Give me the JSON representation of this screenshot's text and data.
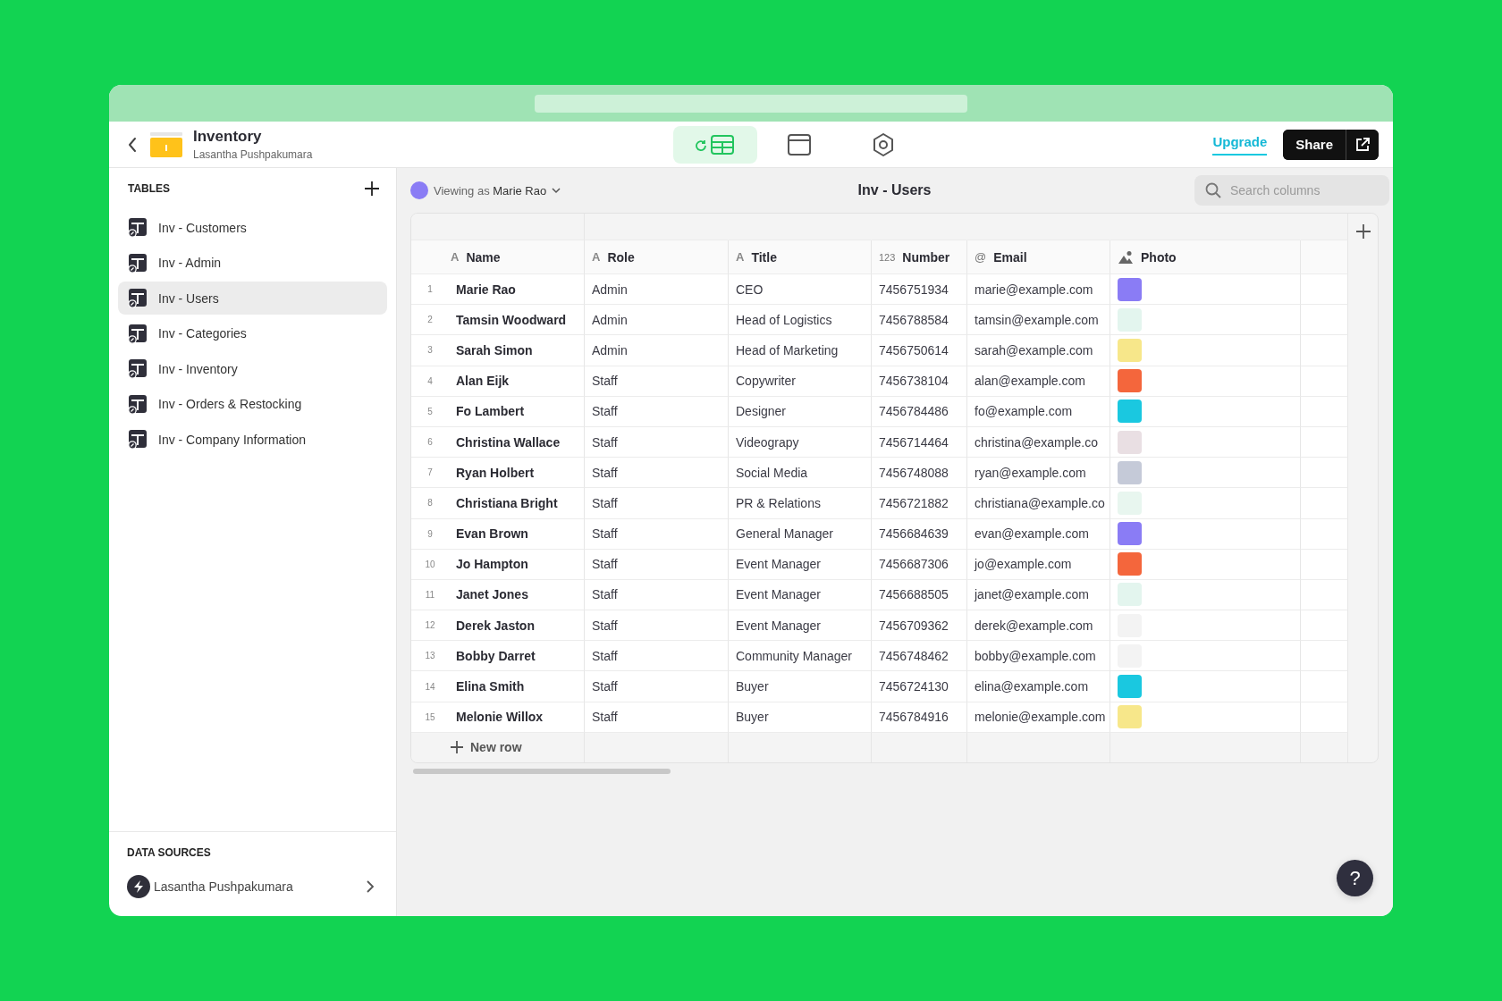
{
  "app": {
    "title": "Inventory",
    "owner": "Lasantha Pushpakumara"
  },
  "view_tabs": [
    {
      "kind": "data",
      "selected": true
    },
    {
      "kind": "layout",
      "selected": false
    },
    {
      "kind": "settings",
      "selected": false
    }
  ],
  "upgrade": "Upgrade",
  "share": "Share",
  "sidebar": {
    "heading": "TABLES",
    "items": [
      {
        "label": "Inv - Customers",
        "selected": false
      },
      {
        "label": "Inv - Admin",
        "selected": false
      },
      {
        "label": "Inv - Users",
        "selected": true
      },
      {
        "label": "Inv - Categories",
        "selected": false
      },
      {
        "label": "Inv - Inventory",
        "selected": false
      },
      {
        "label": "Inv - Orders & Restocking",
        "selected": false
      },
      {
        "label": "Inv - Company Information",
        "selected": false
      }
    ],
    "sources_heading": "DATA SOURCES",
    "source": "Lasantha Pushpakumara"
  },
  "toolbar": {
    "viewing_prefix": "Viewing as",
    "viewing_user": "Marie Rao",
    "title": "Inv - Users",
    "search_placeholder": "Search columns"
  },
  "table": {
    "columns": [
      {
        "label": "Name",
        "kind": "text",
        "glyph": "A"
      },
      {
        "label": "Role",
        "kind": "text",
        "glyph": "A"
      },
      {
        "label": "Title",
        "kind": "text",
        "glyph": "A"
      },
      {
        "label": "Number",
        "kind": "number",
        "glyph": "123"
      },
      {
        "label": "Email",
        "kind": "email",
        "glyph": "@"
      },
      {
        "label": "Photo",
        "kind": "image"
      }
    ],
    "rows": [
      {
        "num": "1",
        "cells": [
          "Marie Rao",
          "Admin",
          "CEO",
          "7456751934",
          "marie@example.com"
        ],
        "photo": {
          "color": "#8a7cf5"
        }
      },
      {
        "num": "2",
        "cells": [
          "Tamsin Woodward",
          "Admin",
          "Head of Logistics",
          "7456788584",
          "tamsin@example.com"
        ],
        "photo": {
          "color": "#e3f5ee"
        }
      },
      {
        "num": "3",
        "cells": [
          "Sarah Simon",
          "Admin",
          "Head of Marketing",
          "7456750614",
          "sarah@example.com"
        ],
        "photo": {
          "color": "#f7e78a"
        }
      },
      {
        "num": "4",
        "cells": [
          "Alan Eijk",
          "Staff",
          "Copywriter",
          "7456738104",
          "alan@example.com"
        ],
        "photo": {
          "color": "#f4663c"
        }
      },
      {
        "num": "5",
        "cells": [
          "Fo Lambert",
          "Staff",
          "Designer",
          "7456784486",
          "fo@example.com"
        ],
        "photo": {
          "color": "#1ac8e0"
        }
      },
      {
        "num": "6",
        "cells": [
          "Christina Wallace",
          "Staff",
          "Videograpy",
          "7456714464",
          "christina@example.co"
        ],
        "photo": {
          "color": "#e9dfe3"
        }
      },
      {
        "num": "7",
        "cells": [
          "Ryan Holbert",
          "Staff",
          "Social Media",
          "7456748088",
          "ryan@example.com"
        ],
        "photo": {
          "color": "#c5cad8"
        }
      },
      {
        "num": "8",
        "cells": [
          "Christiana Bright",
          "Staff",
          "PR & Relations",
          "7456721882",
          "christiana@example.co"
        ],
        "photo": {
          "color": "#e8f6ef"
        }
      },
      {
        "num": "9",
        "cells": [
          "Evan Brown",
          "Staff",
          "General Manager",
          "7456684639",
          "evan@example.com"
        ],
        "photo": {
          "color": "#8a7cf5"
        }
      },
      {
        "num": "10",
        "cells": [
          "Jo Hampton",
          "Staff",
          "Event Manager",
          "7456687306",
          "jo@example.com"
        ],
        "photo": {
          "color": "#f4663c"
        }
      },
      {
        "num": "11",
        "cells": [
          "Janet Jones",
          "Staff",
          "Event Manager",
          "7456688505",
          "janet@example.com"
        ],
        "photo": {
          "color": "#e3f5ee"
        }
      },
      {
        "num": "12",
        "cells": [
          "Derek Jaston",
          "Staff",
          "Event Manager",
          "7456709362",
          "derek@example.com"
        ],
        "photo": {
          "color": "#f3f3f3"
        }
      },
      {
        "num": "13",
        "cells": [
          "Bobby Darret",
          "Staff",
          "Community Manager",
          "7456748462",
          "bobby@example.com"
        ],
        "photo": {
          "color": "#f3f3f3"
        }
      },
      {
        "num": "14",
        "cells": [
          "Elina Smith",
          "Staff",
          "Buyer",
          "7456724130",
          "elina@example.com"
        ],
        "photo": {
          "color": "#1ac8e0"
        }
      },
      {
        "num": "15",
        "cells": [
          "Melonie Willox",
          "Staff",
          "Buyer",
          "7456784916",
          "melonie@example.com"
        ],
        "photo": {
          "color": "#f7e78a"
        }
      }
    ],
    "new_row": "New row"
  },
  "help": "?"
}
